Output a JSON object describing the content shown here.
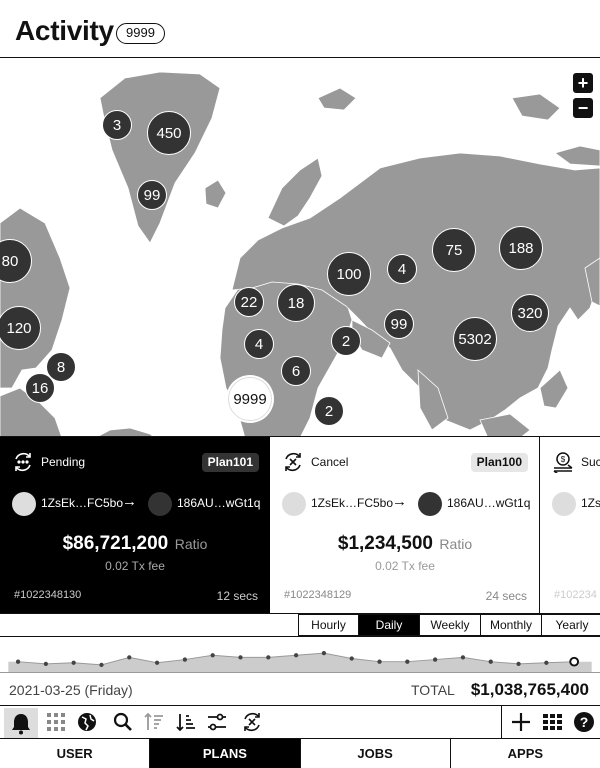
{
  "header": {
    "title": "Activity",
    "count": "9999"
  },
  "map": {
    "clusters": [
      {
        "label": "3",
        "size": "small"
      },
      {
        "label": "450",
        "size": "large"
      },
      {
        "label": "99",
        "size": "small"
      },
      {
        "label": "80",
        "size": "large"
      },
      {
        "label": "120",
        "size": "large"
      },
      {
        "label": "8",
        "size": "small"
      },
      {
        "label": "16",
        "size": "small"
      },
      {
        "label": "22",
        "size": "small"
      },
      {
        "label": "18",
        "size": "medium"
      },
      {
        "label": "4",
        "size": "small"
      },
      {
        "label": "6",
        "size": "small"
      },
      {
        "label": "9999",
        "size": "large",
        "highlight": true
      },
      {
        "label": "100",
        "size": "large"
      },
      {
        "label": "4",
        "size": "small"
      },
      {
        "label": "2",
        "size": "small"
      },
      {
        "label": "99",
        "size": "small"
      },
      {
        "label": "2",
        "size": "small"
      },
      {
        "label": "75",
        "size": "large"
      },
      {
        "label": "188",
        "size": "large"
      },
      {
        "label": "320",
        "size": "medium"
      },
      {
        "label": "5302",
        "size": "large"
      }
    ],
    "zoom_in": "+",
    "zoom_out": "−"
  },
  "cards": [
    {
      "status": "Pending",
      "plan": "Plan101",
      "from": "1ZsEk…FC5bo",
      "to": "186AU…wGt1q",
      "amount": "$86,721,200",
      "ratio": "Ratio",
      "fee": "0.02 Tx fee",
      "txid": "#1022348130",
      "time": "12 secs",
      "icon": "pending-icon",
      "theme": "dark"
    },
    {
      "status": "Cancel",
      "plan": "Plan100",
      "from": "1ZsEk…FC5bo",
      "to": "186AU…wGt1q",
      "amount": "$1,234,500",
      "ratio": "Ratio",
      "fee": "0.02 Tx fee",
      "txid": "#1022348129",
      "time": "24 secs",
      "icon": "cancel-icon",
      "theme": "light"
    },
    {
      "status": "Suc",
      "from": "1Zs",
      "txid": "#102234",
      "icon": "dollar-exchange-icon",
      "theme": "light"
    }
  ],
  "range_tabs": [
    "Hourly",
    "Daily",
    "Weekly",
    "Monthly",
    "Yearly"
  ],
  "range_active": "Daily",
  "sparkline": {
    "values": [
      10,
      9,
      9.5,
      8.5,
      12,
      9.5,
      11,
      13,
      12,
      12,
      13,
      14,
      11.5,
      10,
      10,
      11,
      12,
      10,
      9,
      9.5,
      10
    ],
    "fill": "#cccccc",
    "color": "#444444"
  },
  "summary": {
    "date": "2021-03-25 (Friday)",
    "total_label": "TOTAL",
    "total_value": "$1,038,765,400"
  },
  "toolbar": {
    "left_icons": [
      "bell-icon",
      "grid-dots-icon",
      "globe-icon",
      "search-icon",
      "sort-asc-icon",
      "sort-desc-icon",
      "filter-sliders-icon",
      "cancel-exchange-icon"
    ],
    "right_icons": [
      "plus-icon",
      "grid-list-icon",
      "help-icon"
    ],
    "active": "bell-icon"
  },
  "nav": {
    "items": [
      "USER",
      "PLANS",
      "JOBS",
      "APPS"
    ],
    "active": "PLANS"
  }
}
